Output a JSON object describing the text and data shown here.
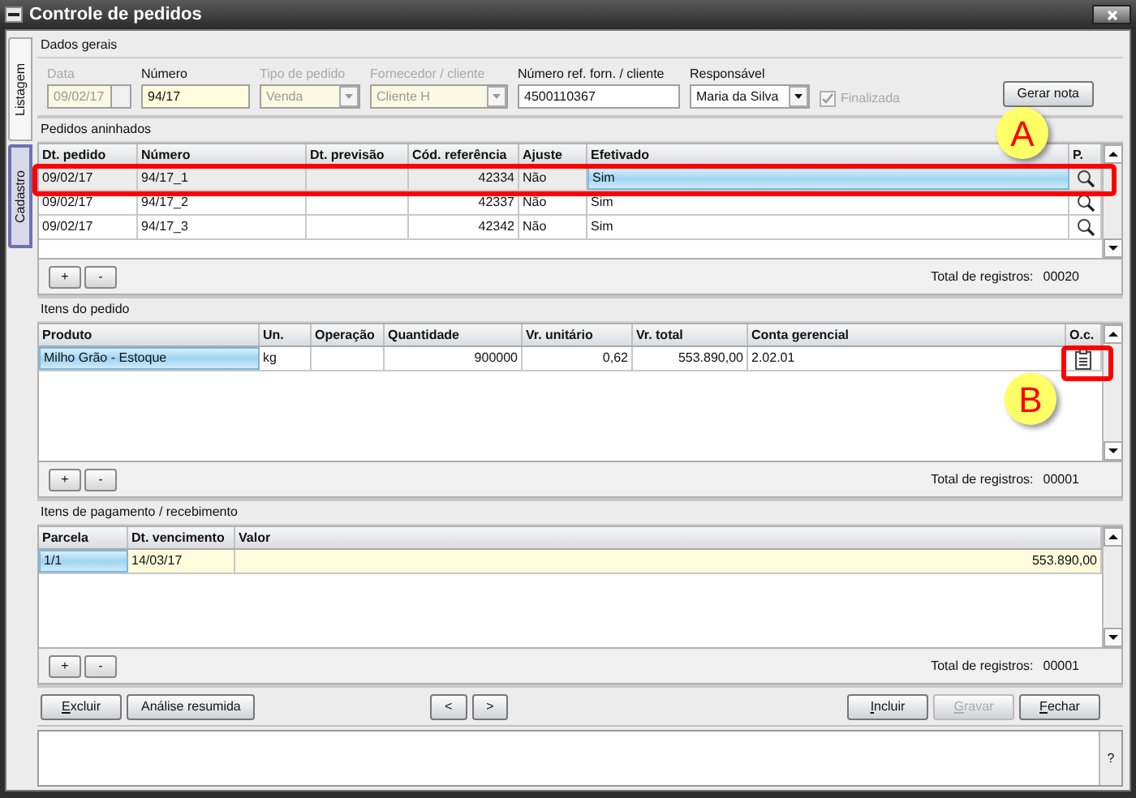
{
  "window": {
    "title": "Controle de pedidos"
  },
  "side_tabs": [
    {
      "label": "Listagem",
      "selected": false
    },
    {
      "label": "Cadastro",
      "selected": true
    }
  ],
  "general": {
    "title": "Dados gerais",
    "fields": [
      {
        "kind": "date",
        "label": "Data",
        "value": "09/02/17",
        "disabled": true,
        "required": true
      },
      {
        "kind": "text",
        "label": "Número",
        "value": "94/17",
        "disabled": false,
        "required": true
      },
      {
        "kind": "select",
        "label": "Tipo de pedido",
        "value": "Venda",
        "disabled": true,
        "required": true
      },
      {
        "kind": "select",
        "label": "Fornecedor / cliente",
        "value": "Cliente H",
        "disabled": true,
        "required": true
      },
      {
        "kind": "text",
        "label": "Número ref. forn. / cliente",
        "value": "4500110367",
        "disabled": false,
        "required": false
      },
      {
        "kind": "select",
        "label": "Responsável",
        "value": "Maria da Silva",
        "disabled": false,
        "required": false
      },
      {
        "kind": "checkbox",
        "label": "Finalizada",
        "checked": true,
        "disabled": true
      }
    ],
    "button": "Gerar nota"
  },
  "tables": [
    {
      "title": "Pedidos aninhados",
      "columns": [
        "Dt. pedido",
        "Número",
        "Dt. previsão",
        "Cód. referência",
        "Ajuste",
        "Efetivado",
        "P."
      ],
      "rows": [
        {
          "selected": true,
          "cells": [
            {
              "kind": "text",
              "text": "09/02/17",
              "selected": false
            },
            {
              "kind": "text",
              "text": "94/17_1",
              "selected": false
            },
            {
              "kind": "empty",
              "selected": false
            },
            {
              "kind": "number",
              "text": "42334",
              "selected": false
            },
            {
              "kind": "text",
              "text": "Não",
              "selected": false
            },
            {
              "kind": "text",
              "text": "Sim",
              "selected": true
            },
            {
              "kind": "magnifier",
              "selected": false
            }
          ]
        },
        {
          "selected": false,
          "cells": [
            {
              "kind": "text",
              "text": "09/02/17",
              "selected": false
            },
            {
              "kind": "text",
              "text": "94/17_2",
              "selected": false
            },
            {
              "kind": "empty",
              "selected": false
            },
            {
              "kind": "number",
              "text": "42337",
              "selected": false
            },
            {
              "kind": "text",
              "text": "Não",
              "selected": false
            },
            {
              "kind": "text",
              "text": "Sim",
              "selected": false
            },
            {
              "kind": "magnifier",
              "selected": false
            }
          ]
        },
        {
          "selected": false,
          "cells": [
            {
              "kind": "text",
              "text": "09/02/17",
              "selected": false
            },
            {
              "kind": "text",
              "text": "94/17_3",
              "selected": false
            },
            {
              "kind": "empty",
              "selected": false
            },
            {
              "kind": "number",
              "text": "42342",
              "selected": false
            },
            {
              "kind": "text",
              "text": "Não",
              "selected": false
            },
            {
              "kind": "text",
              "text": "Sim",
              "selected": false
            },
            {
              "kind": "magnifier",
              "selected": false
            }
          ]
        }
      ],
      "add": "+",
      "remove": "-",
      "total_label": "Total de registros:",
      "total": "00020"
    },
    {
      "title": "Itens do pedido",
      "columns": [
        "Produto",
        "Un.",
        "Operação",
        "Quantidade",
        "Vr. unitário",
        "Vr. total",
        "Conta gerencial",
        "O.c."
      ],
      "rows": [
        {
          "selected": false,
          "cells": [
            {
              "kind": "text",
              "text": "Milho Grão - Estoque",
              "selected": true
            },
            {
              "kind": "text",
              "text": "kg",
              "selected": false
            },
            {
              "kind": "empty",
              "selected": false
            },
            {
              "kind": "number",
              "text": "900000",
              "selected": false
            },
            {
              "kind": "number",
              "text": "0,62",
              "selected": false
            },
            {
              "kind": "number",
              "text": "553.890,00",
              "selected": false
            },
            {
              "kind": "text",
              "text": "2.02.01",
              "selected": false
            },
            {
              "kind": "clipboard",
              "selected": false
            }
          ]
        }
      ],
      "add": "+",
      "remove": "-",
      "total_label": "Total de registros:",
      "total": "00001"
    },
    {
      "title": "Itens de pagamento / recebimento",
      "columns": [
        "Parcela",
        "Dt. vencimento",
        "Valor"
      ],
      "rows": [
        {
          "selected": true,
          "cells": [
            {
              "kind": "text",
              "text": "1/1",
              "selected": true
            },
            {
              "kind": "text",
              "text": "14/03/17",
              "selected": false
            },
            {
              "kind": "number",
              "text": "553.890,00",
              "selected": false
            }
          ]
        }
      ],
      "add": "+",
      "remove": "-",
      "total_label": "Total de registros:",
      "total": "00001"
    }
  ],
  "actions": {
    "left": [
      {
        "label": "Excluir",
        "disabled": false,
        "mnemonic": true
      },
      {
        "label": "Análise resumida",
        "disabled": false,
        "mnemonic": false
      }
    ],
    "middle": [
      {
        "label": "<",
        "disabled": false,
        "mnemonic": false
      },
      {
        "label": ">",
        "disabled": false,
        "mnemonic": false
      }
    ],
    "right": [
      {
        "label": "Incluir",
        "disabled": false,
        "mnemonic": true
      },
      {
        "label": "Gravar",
        "disabled": true,
        "mnemonic": true
      },
      {
        "label": "Fechar",
        "disabled": false,
        "mnemonic": true
      }
    ]
  },
  "help": "?",
  "callouts": [
    {
      "letter": "A"
    },
    {
      "letter": "B"
    }
  ]
}
